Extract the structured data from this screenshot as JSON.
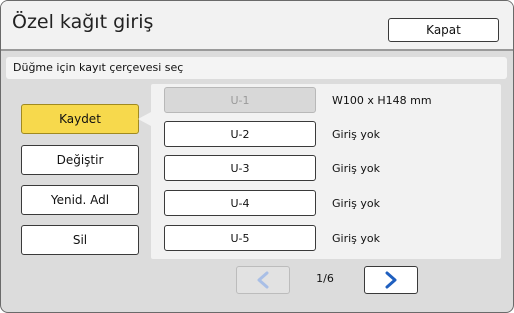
{
  "dialog": {
    "title": "Özel kağıt giriş",
    "close_label": "Kapat"
  },
  "instruction": "Düğme için kayıt çerçevesi seç",
  "side_buttons": [
    {
      "label": "Kaydet",
      "active": true
    },
    {
      "label": "Değiştir",
      "active": false
    },
    {
      "label": "Yenid. Adl",
      "active": false
    },
    {
      "label": "Sil",
      "active": false
    }
  ],
  "slots": [
    {
      "label": "U-1",
      "info": "W100 x H148 mm",
      "disabled": true
    },
    {
      "label": "U-2",
      "info": "Giriş yok",
      "disabled": false
    },
    {
      "label": "U-3",
      "info": "Giriş yok",
      "disabled": false
    },
    {
      "label": "U-4",
      "info": "Giriş yok",
      "disabled": false
    },
    {
      "label": "U-5",
      "info": "Giriş yok",
      "disabled": false
    }
  ],
  "pager": {
    "indicator": "1/6",
    "prev_enabled": false,
    "next_enabled": true
  },
  "colors": {
    "selected": "#f7d94c",
    "arrow_enabled": "#1f5fbf",
    "arrow_disabled": "#a9bfe6"
  }
}
